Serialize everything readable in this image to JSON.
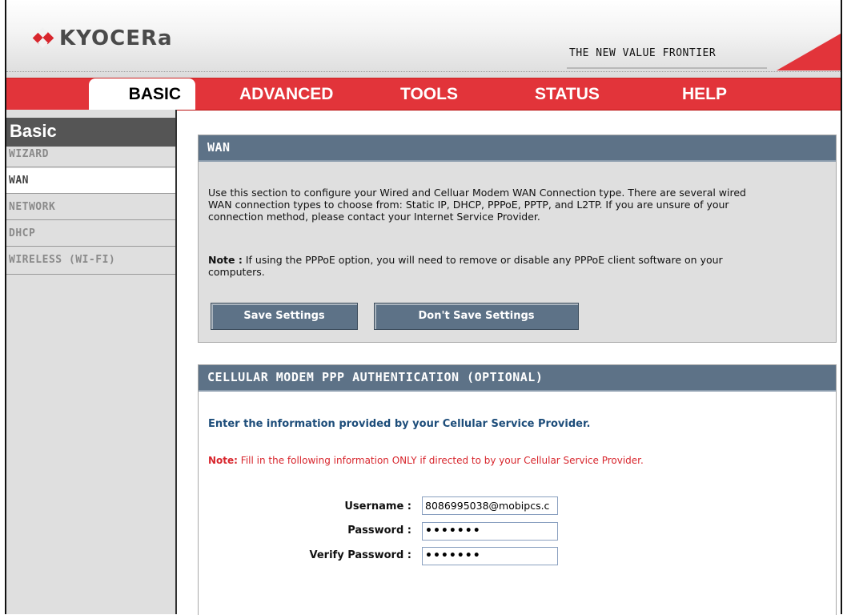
{
  "header": {
    "logo_text": "KYOCERa",
    "tagline": "THE NEW VALUE FRONTIER"
  },
  "nav": {
    "tabs": [
      {
        "label": "BASIC",
        "active": true
      },
      {
        "label": "ADVANCED",
        "active": false
      },
      {
        "label": "TOOLS",
        "active": false
      },
      {
        "label": "STATUS",
        "active": false
      },
      {
        "label": "HELP",
        "active": false
      }
    ]
  },
  "sidebar": {
    "title": "Basic",
    "items": [
      {
        "label": "WIZARD",
        "active": false
      },
      {
        "label": "WAN",
        "active": true
      },
      {
        "label": "NETWORK",
        "active": false
      },
      {
        "label": "DHCP",
        "active": false
      },
      {
        "label": "WIRELESS (WI-FI)",
        "active": false
      }
    ]
  },
  "wan": {
    "heading": "WAN",
    "description_lines": [
      "Use this section to configure your Wired and Celluar Modem WAN Connection type. There are several wired",
      "WAN connection types to choose from: Static IP, DHCP, PPPoE, PPTP, and L2TP. If you are unsure of your",
      "connection method, please contact your Internet Service Provider."
    ],
    "note_label": "Note :",
    "note_line1": " If using the PPPoE option, you will need to remove or disable any PPPoE client software on your",
    "note_line2": "computers.",
    "save_label": "Save Settings",
    "dont_save_label": "Don't Save Settings"
  },
  "ppp": {
    "heading": "CELLULAR MODEM PPP AUTHENTICATION (OPTIONAL)",
    "intro": "Enter the information provided by your Cellular Service Provider.",
    "note_label": "Note:",
    "note_text": " Fill in the following information ONLY if directed to by your Cellular Service Provider.",
    "username_label": "Username :",
    "username_value": "8086995038@mobipcs.c",
    "password_label": "Password :",
    "password_value": "•••••••",
    "verify_label": "Verify Password :",
    "verify_value": "•••••••"
  },
  "colors": {
    "nav_red": "#e2343a",
    "panel_header": "#5d7287",
    "note_red": "#d8262d",
    "intro_blue": "#1d4d7a"
  }
}
